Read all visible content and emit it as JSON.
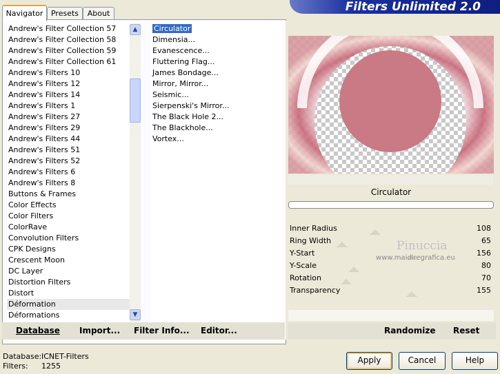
{
  "header": {
    "title": "Filters Unlimited 2.0"
  },
  "tabs": [
    "Navigator",
    "Presets",
    "About"
  ],
  "categories": {
    "items": [
      "Andrew's Filter Collection 57",
      "Andrew's Filter Collection 58",
      "Andrew's Filter Collection 59",
      "Andrew's Filter Collection 61",
      "Andrew's Filters 10",
      "Andrew's Filters 12",
      "Andrew's Filters 14",
      "Andrew's Filters 1",
      "Andrew's Filters 27",
      "Andrew's Filters 29",
      "Andrew's Filters 44",
      "Andrew's Filters 51",
      "Andrew's Filters 52",
      "Andrew's Filters 6",
      "Andrew's Filters 8",
      "Buttons & Frames",
      "Color Effects",
      "Color Filters",
      "ColorRave",
      "Convolution Filters",
      "CPK Designs",
      "Crescent Moon",
      "DC Layer",
      "Distortion Filters",
      "Distort",
      "Déformation",
      "Déformations"
    ],
    "selected": "Déformation"
  },
  "filters": {
    "items": [
      "Circulator",
      "Dimensia...",
      "Evanescence...",
      "Fluttering Flag...",
      "James Bondage...",
      "Mirror, Mirror...",
      "Seismic...",
      "Sierpenski's Mirror...",
      "The Black Hole 2...",
      "The Blackhole...",
      "Vortex..."
    ],
    "selected": "Circulator"
  },
  "left_toolbar": {
    "database": "Database",
    "import": "Import...",
    "filter_info": "Filter Info...",
    "editor": "Editor..."
  },
  "preview": {
    "filter_name": "Circulator"
  },
  "params": [
    {
      "name": "Inner Radius",
      "value": "108",
      "level": 0.42
    },
    {
      "name": "Ring Width",
      "value": "65",
      "level": 0.25
    },
    {
      "name": "Y-Start",
      "value": "156",
      "level": 0.61
    },
    {
      "name": "Y-Scale",
      "value": "80",
      "level": 0.31
    },
    {
      "name": "Rotation",
      "value": "70",
      "level": 0.27
    },
    {
      "name": "Transparency",
      "value": "155",
      "level": 0.61
    }
  ],
  "watermark": {
    "line1": "Pinuccia",
    "line2": "www.maidiregrafica.eu"
  },
  "right_toolbar": {
    "randomize": "Randomize",
    "reset": "Reset"
  },
  "status": {
    "database_label": "Database:",
    "database_value": "ICNET-Filters",
    "filters_label": "Filters:",
    "filters_value": "1255"
  },
  "buttons": {
    "apply": "Apply",
    "cancel": "Cancel",
    "help": "Help"
  },
  "colors": {
    "header_bg": "#1a2fa0",
    "selection": "#316ac5",
    "ring": "#c86878",
    "disk": "#c97a84"
  }
}
